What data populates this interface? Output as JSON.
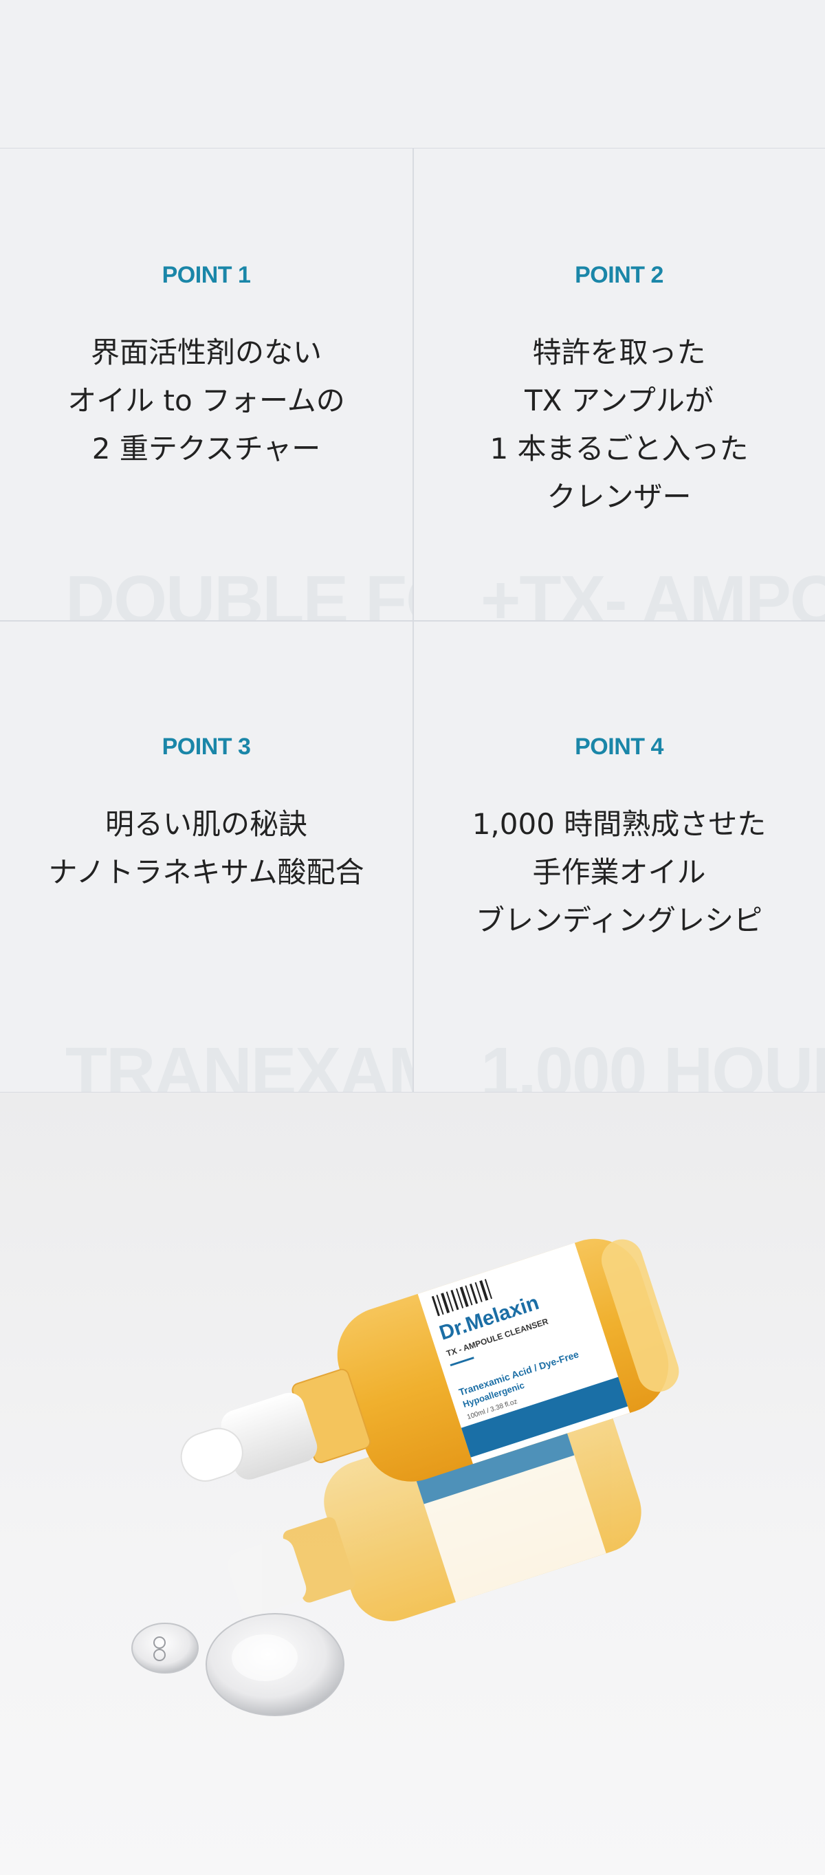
{
  "points": [
    {
      "label": "POINT 1",
      "desc": "界面活性剤のない\nオイル to フォームの\n2 重テクスチャー",
      "ghost": "DOUBLE FO"
    },
    {
      "label": "POINT 2",
      "desc": "特許を取った\nTX アンプルが\n1 本まるごと入った\nクレンザー",
      "ghost": "+TX- AMPO"
    },
    {
      "label": "POINT 3",
      "desc": "明るい肌の秘訣\nナノトラネキサム酸配合",
      "ghost": "TRANEXAM"
    },
    {
      "label": "POINT 4",
      "desc": "1,000 時間熟成させた\n手作業オイル\nブレンディングレシピ",
      "ghost": "1,000 HOUR"
    }
  ],
  "product": {
    "brand": "Dr.Melaxin",
    "name": "TX - AMPOULE CLEANSER",
    "claim": "Tranexamic Acid / Dye-Free",
    "sub": "Hypoallergenic",
    "volume": "100ml / 3.38 fl.oz"
  }
}
